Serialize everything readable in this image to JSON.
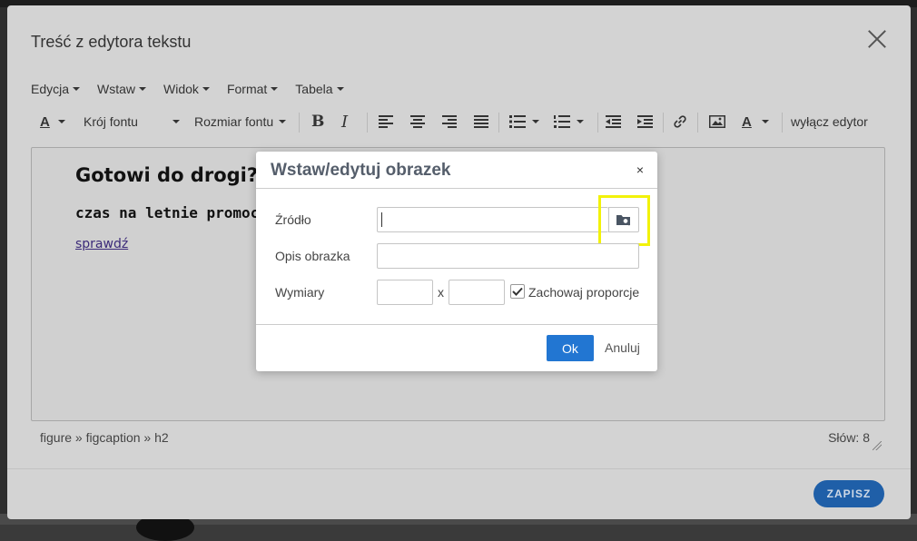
{
  "modal": {
    "title": "Treść z edytora tekstu",
    "close_icon": "close-icon",
    "save_label": "ZAPISZ"
  },
  "menubar": {
    "items": [
      {
        "label": "Edycja"
      },
      {
        "label": "Wstaw"
      },
      {
        "label": "Widok"
      },
      {
        "label": "Format"
      },
      {
        "label": "Tabela"
      }
    ]
  },
  "toolbar": {
    "text_color_glyph": "A",
    "font_family_label": "Krój fontu",
    "font_size_label": "Rozmiar fontu",
    "bold_glyph": "B",
    "italic_glyph": "I",
    "bg_color_glyph": "A",
    "disable_editor_label": "wyłącz edytor",
    "icons": [
      "text-color-icon",
      "bold-icon",
      "italic-icon",
      "align-left-icon",
      "align-center-icon",
      "align-right-icon",
      "align-justify-icon",
      "bullet-list-icon",
      "numbered-list-icon",
      "outdent-icon",
      "indent-icon",
      "link-icon",
      "image-icon",
      "background-color-icon"
    ]
  },
  "editor": {
    "heading": "Gotowi do drogi?",
    "subheading": "czas na letnie promoc",
    "link_text": "sprawdź",
    "path": "figure » figcaption » h2",
    "word_count": "Słów: 8"
  },
  "dialog": {
    "title": "Wstaw/edytuj obrazek",
    "close_glyph": "×",
    "source_label": "Źródło",
    "source_value": "",
    "alt_label": "Opis obrazka",
    "alt_value": "",
    "dimensions_label": "Wymiary",
    "width_value": "",
    "height_value": "",
    "dimension_separator": "x",
    "constrain_label": "Zachowaj proporcje",
    "constrain_checked": true,
    "ok_label": "Ok",
    "cancel_label": "Anuluj",
    "browse_icon": "folder-search-icon",
    "highlight_color": "#f2f20a"
  },
  "colors": {
    "save_button": "#1f5fa8",
    "ok_button": "#2276d2",
    "link": "#3b2a79"
  }
}
